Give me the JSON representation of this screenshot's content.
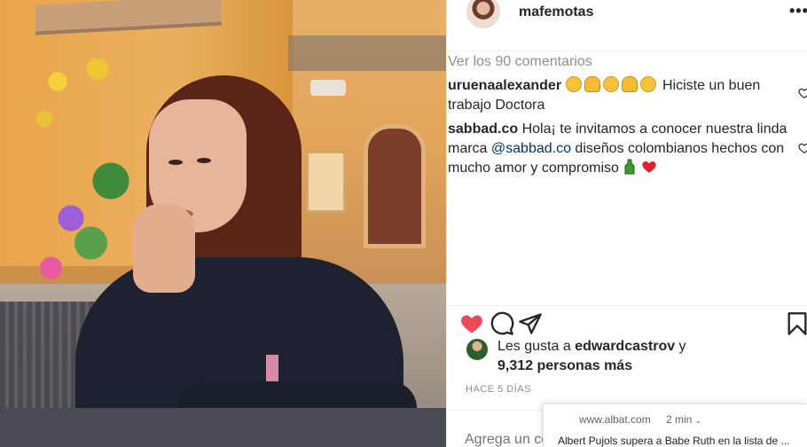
{
  "post": {
    "username": "mafemotas",
    "more_label": "•••",
    "view_comments": "Ver los 90 comentarios",
    "comments": [
      {
        "user": "uruenaalexander",
        "text": "Hiciste un buen trabajo Doctora"
      },
      {
        "user": "sabbad.co",
        "text_before": "Hola¡ te invitamos a conocer nuestra linda marca ",
        "mention": "@sabbad.co",
        "text_after": " diseños colombianos hechos con mucho amor y compromiso "
      }
    ],
    "likes": {
      "prefix": "Les gusta a ",
      "user": "edwardcastrov",
      "suffix": " y",
      "count_text": "9,312 personas más"
    },
    "date": "HACE 5 DÍAS",
    "add_comment_placeholder": "Agrega un comentario..."
  },
  "notification": {
    "source": "www.albat.com",
    "time": "2 min",
    "title": "Albert Pujols supera a Babe Ruth en la lista de ..."
  },
  "colors": {
    "like_red": "#ed4956",
    "link_blue": "#00376b",
    "muted_gray": "#8e8e8e"
  }
}
